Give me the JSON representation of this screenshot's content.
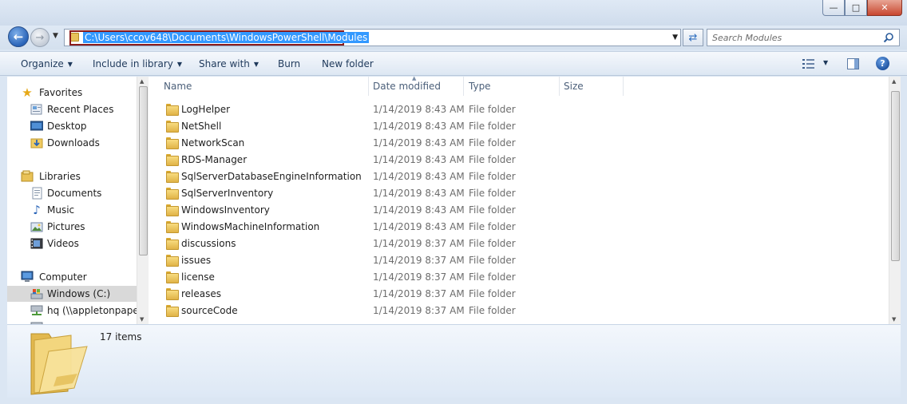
{
  "window": {
    "controls": [
      "minimize",
      "maximize",
      "close"
    ]
  },
  "address_bar": {
    "path": "C:\\Users\\ccov648\\Documents\\WindowsPowerShell\\Modules"
  },
  "search": {
    "placeholder": "Search Modules"
  },
  "toolbar": {
    "organize": "Organize",
    "include_in_library": "Include in library",
    "share_with": "Share with",
    "burn": "Burn",
    "new_folder": "New folder"
  },
  "nav": {
    "favorites": {
      "header": "Favorites",
      "items": [
        "Recent Places",
        "Desktop",
        "Downloads"
      ]
    },
    "libraries": {
      "header": "Libraries",
      "items": [
        "Documents",
        "Music",
        "Pictures",
        "Videos"
      ]
    },
    "computer": {
      "header": "Computer",
      "items": [
        "Windows (C:)",
        "hq (\\\\appletonpapers"
      ]
    }
  },
  "columns": {
    "name": "Name",
    "date_modified": "Date modified",
    "type": "Type",
    "size": "Size"
  },
  "files": [
    {
      "name": "LogHelper",
      "date": "1/14/2019 8:43 AM",
      "type": "File folder"
    },
    {
      "name": "NetShell",
      "date": "1/14/2019 8:43 AM",
      "type": "File folder"
    },
    {
      "name": "NetworkScan",
      "date": "1/14/2019 8:43 AM",
      "type": "File folder"
    },
    {
      "name": "RDS-Manager",
      "date": "1/14/2019 8:43 AM",
      "type": "File folder"
    },
    {
      "name": "SqlServerDatabaseEngineInformation",
      "date": "1/14/2019 8:43 AM",
      "type": "File folder"
    },
    {
      "name": "SqlServerInventory",
      "date": "1/14/2019 8:43 AM",
      "type": "File folder"
    },
    {
      "name": "WindowsInventory",
      "date": "1/14/2019 8:43 AM",
      "type": "File folder"
    },
    {
      "name": "WindowsMachineInformation",
      "date": "1/14/2019 8:43 AM",
      "type": "File folder"
    },
    {
      "name": "discussions",
      "date": "1/14/2019 8:37 AM",
      "type": "File folder"
    },
    {
      "name": "issues",
      "date": "1/14/2019 8:37 AM",
      "type": "File folder"
    },
    {
      "name": "license",
      "date": "1/14/2019 8:37 AM",
      "type": "File folder"
    },
    {
      "name": "releases",
      "date": "1/14/2019 8:37 AM",
      "type": "File folder"
    },
    {
      "name": "sourceCode",
      "date": "1/14/2019 8:37 AM",
      "type": "File folder"
    }
  ],
  "details": {
    "item_count": "17 items"
  },
  "colors": {
    "selection": "#3399ff",
    "highlight_box": "#8a1b1b",
    "nav_selected": "#d9d9d9"
  }
}
